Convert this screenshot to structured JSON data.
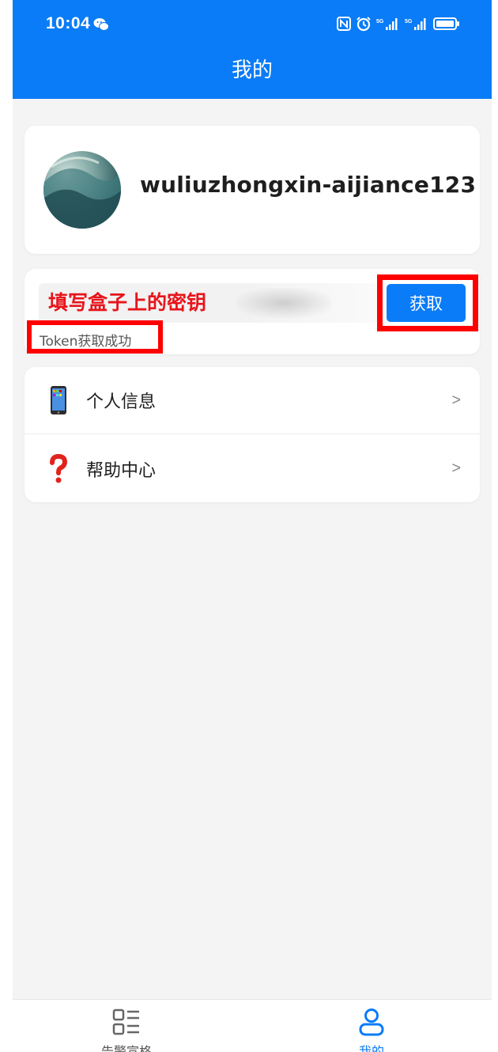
{
  "status_bar": {
    "time": "10:04"
  },
  "header": {
    "title": "我的"
  },
  "profile": {
    "username": "wuliuzhongxin-aijiance123"
  },
  "token": {
    "input_value": "填写盒子上的密钥",
    "fetch_button_label": "获取",
    "status_text": "Token获取成功"
  },
  "menu": {
    "items": [
      {
        "label": "个人信息",
        "chevron": ">",
        "icon": "mobile-phone-icon"
      },
      {
        "label": "帮助中心",
        "chevron": ">",
        "icon": "question-mark-icon"
      }
    ]
  },
  "bottom_nav": {
    "items": [
      {
        "label": "告警宣格",
        "icon": "list-grid-icon",
        "active": false
      },
      {
        "label": "我的",
        "icon": "user-icon",
        "active": true
      }
    ]
  },
  "colors": {
    "primary": "#0a7cf7",
    "annotation_red": "#ff0000",
    "background": "#f4f4f4"
  }
}
